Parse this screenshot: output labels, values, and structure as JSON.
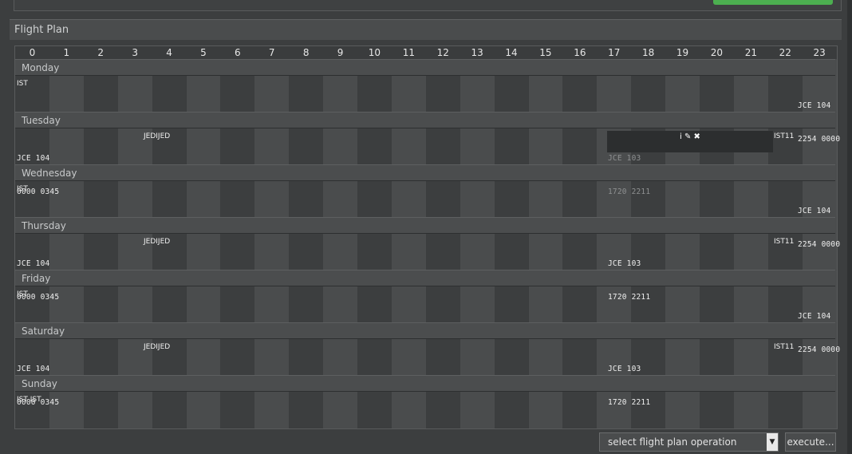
{
  "section": {
    "title": "Flight Plan"
  },
  "hours": [
    "0",
    "1",
    "2",
    "3",
    "4",
    "5",
    "6",
    "7",
    "8",
    "9",
    "10",
    "11",
    "12",
    "13",
    "14",
    "15",
    "16",
    "17",
    "18",
    "19",
    "20",
    "21",
    "22",
    "23"
  ],
  "days": {
    "monday": {
      "label": "Monday",
      "ist_left": "IST",
      "right_flight": {
        "code": "JCE 104",
        "times": "2254 0000"
      }
    },
    "tuesday": {
      "label": "Tuesday",
      "left_flight": {
        "code": "JCE 104",
        "times": "0000 0345"
      },
      "overlap_text": "JEDIJED",
      "mid_flight": {
        "code": "JCE 103",
        "times": "1720 2211"
      },
      "icons": "i ✎ ✖",
      "right_text": "IST11"
    },
    "wednesday": {
      "label": "Wednesday",
      "ist_left": "IST",
      "right_flight": {
        "code": "JCE 104",
        "times": "2254 0000"
      }
    },
    "thursday": {
      "label": "Thursday",
      "left_flight": {
        "code": "JCE 104",
        "times": "0000 0345"
      },
      "overlap_text": "JEDIJED",
      "mid_flight": {
        "code": "JCE 103",
        "times": "1720 2211"
      },
      "right_text": "IST11"
    },
    "friday": {
      "label": "Friday",
      "ist_left": "IST",
      "right_flight": {
        "code": "JCE 104",
        "times": "2254 0000"
      }
    },
    "saturday": {
      "label": "Saturday",
      "left_flight": {
        "code": "JCE 104",
        "times": "0000 0345"
      },
      "overlap_text": "JEDIJED",
      "mid_flight": {
        "code": "JCE 103",
        "times": "1720 2211"
      },
      "right_text": "IST11"
    },
    "sunday": {
      "label": "Sunday",
      "ist_left": "IST IST"
    }
  },
  "controls": {
    "select_label": "select flight plan operation",
    "execute_label": "execute..."
  }
}
